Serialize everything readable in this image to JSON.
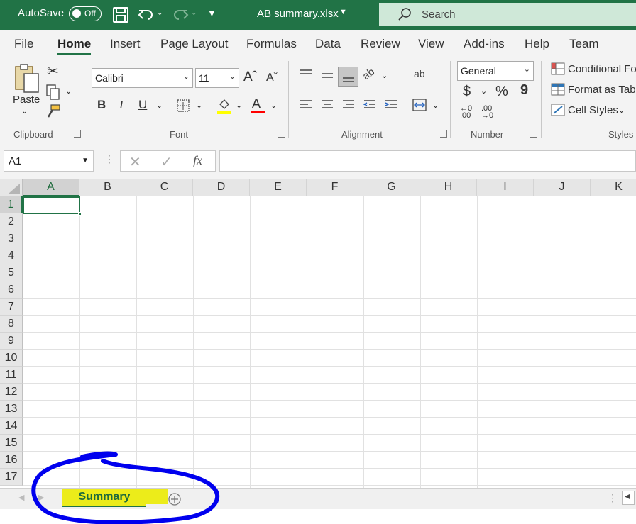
{
  "titlebar": {
    "autosave_label": "AutoSave",
    "autosave_state": "Off",
    "document_title": "AB summary.xlsx",
    "search_placeholder": "Search",
    "accent_color": "#217346"
  },
  "ribbon_tabs": [
    "File",
    "Home",
    "Insert",
    "Page Layout",
    "Formulas",
    "Data",
    "Review",
    "View",
    "Add-ins",
    "Help",
    "Team"
  ],
  "active_tab": "Home",
  "clipboard": {
    "paste_label": "Paste",
    "group_label": "Clipboard"
  },
  "font": {
    "font_name": "Calibri",
    "font_size": "11",
    "bold": "B",
    "italic": "I",
    "underline": "U",
    "group_label": "Font",
    "highlight_color": "#ffff00",
    "font_color": "#ff0000"
  },
  "alignment": {
    "group_label": "Alignment"
  },
  "number": {
    "format": "General",
    "currency": "$",
    "percent": "%",
    "comma": "9",
    "group_label": "Number"
  },
  "styles": {
    "conditional": "Conditional Fo",
    "format_table": "Format as Tabl",
    "cell_styles": "Cell Styles",
    "group_label": "Styles"
  },
  "formula_bar": {
    "name_box": "A1",
    "formula": ""
  },
  "grid": {
    "columns": [
      "A",
      "B",
      "C",
      "D",
      "E",
      "F",
      "G",
      "H",
      "I",
      "J",
      "K"
    ],
    "rows": [
      "1",
      "2",
      "3",
      "4",
      "5",
      "6",
      "7",
      "8",
      "9",
      "10",
      "11",
      "12",
      "13",
      "14",
      "15",
      "16",
      "17"
    ],
    "active_cell": "A1"
  },
  "sheets": {
    "active_sheet": "Summary"
  },
  "annotation": {
    "circle_color": "#0000ee",
    "highlight_color": "#ecec1a"
  }
}
